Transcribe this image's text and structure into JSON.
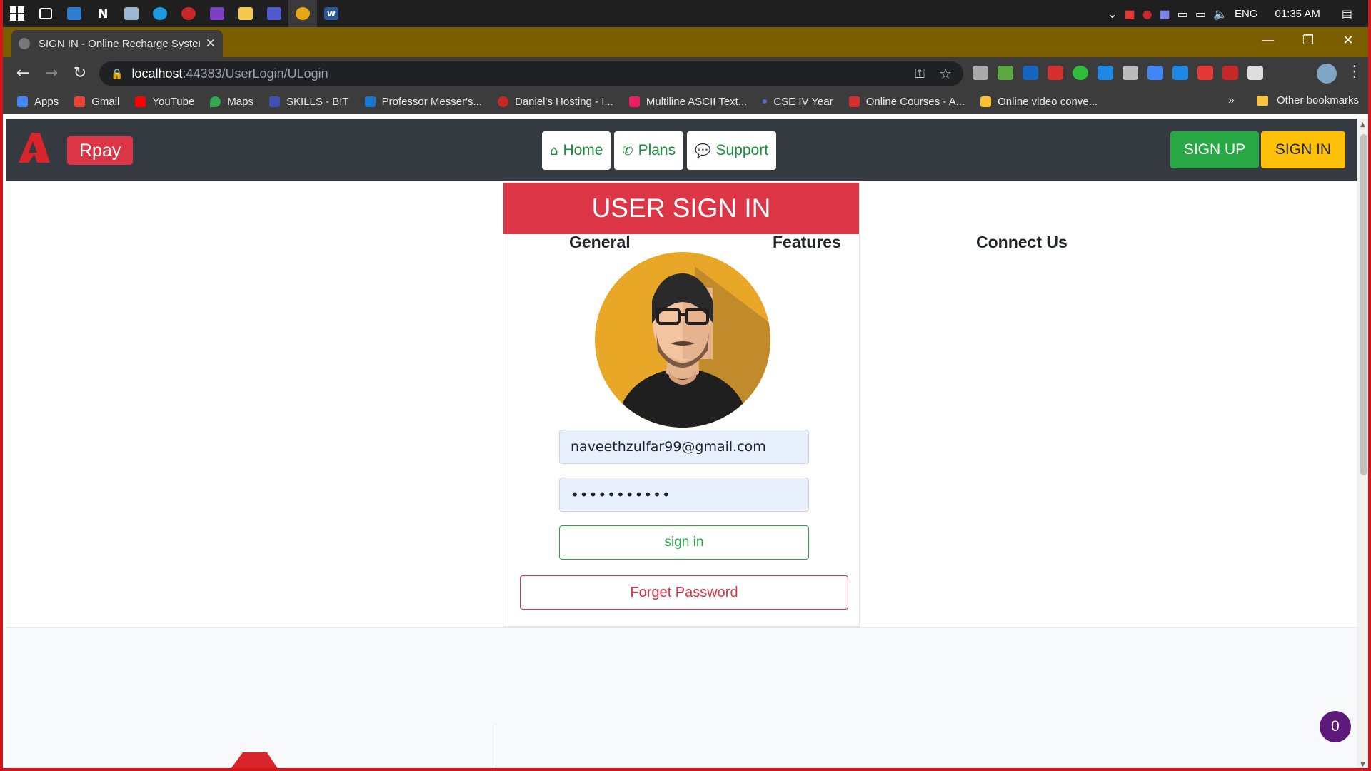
{
  "taskbar": {
    "icons": [
      "start-icon",
      "task-view-icon",
      "calculator-icon",
      "notion-icon",
      "photos-icon",
      "edge-icon",
      "app-icon",
      "visual-studio-icon",
      "file-explorer-icon",
      "teams-icon",
      "chrome-icon",
      "word-icon"
    ],
    "tray": {
      "language": "ENG",
      "time": "01:35 AM"
    }
  },
  "browser": {
    "tab_title": "SIGN IN - Online Recharge Syster",
    "url_host": "localhost",
    "url_path": ":44383/UserLogin/ULogin",
    "bookmarks": [
      {
        "label": "Apps",
        "color": "#4285f4"
      },
      {
        "label": "Gmail",
        "color": "#ea4335"
      },
      {
        "label": "YouTube",
        "color": "#ff0000"
      },
      {
        "label": "Maps",
        "color": "#34a853"
      },
      {
        "label": "SKILLS - BIT",
        "color": "#3f51b5"
      },
      {
        "label": "Professor Messer's...",
        "color": "#1976d2"
      },
      {
        "label": "Daniel's Hosting - I...",
        "color": "#c62828"
      },
      {
        "label": "Multiline ASCII Text...",
        "color": "#e91e63"
      },
      {
        "label": "CSE IV Year",
        "color": "#5c6bc0"
      },
      {
        "label": "Online Courses - A...",
        "color": "#d32f2f"
      },
      {
        "label": "Online video conve...",
        "color": "#fbc02d"
      }
    ],
    "bookmarks_more": "»",
    "other_bookmarks": "Other bookmarks"
  },
  "site": {
    "brand": "Rpay",
    "nav": {
      "home": "Home",
      "plans": "Plans",
      "support": "Support"
    },
    "signup": "SIGN UP",
    "signin": "SIGN IN"
  },
  "login": {
    "title": "USER SIGN IN",
    "email_value": "naveethzulfar99@gmail.com",
    "password_value": "•••••••••••",
    "submit_label": "sign in",
    "forget_label": "Forget Password"
  },
  "footer": {
    "col1": "General",
    "col2": "Features",
    "col3": "Connect Us"
  },
  "chat_badge": "0",
  "colors": {
    "brand_red": "#dc3545",
    "success_green": "#28a745",
    "warning_yellow": "#ffc107",
    "navbar_dark": "#343a40"
  }
}
